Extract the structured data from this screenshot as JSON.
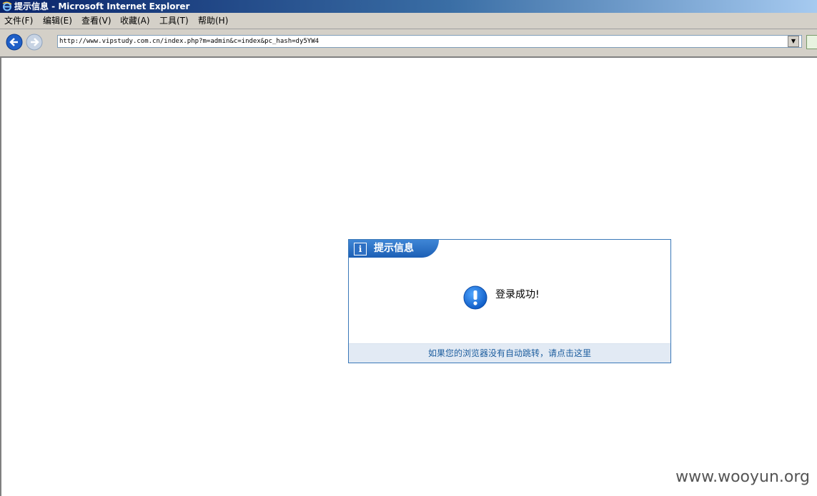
{
  "window": {
    "title": "提示信息 - Microsoft Internet Explorer",
    "icon": "ie-icon"
  },
  "menu": {
    "items": [
      {
        "label": "文件(F)"
      },
      {
        "label": "编辑(E)"
      },
      {
        "label": "查看(V)"
      },
      {
        "label": "收藏(A)"
      },
      {
        "label": "工具(T)"
      },
      {
        "label": "帮助(H)"
      }
    ]
  },
  "navbar": {
    "back_icon": "back-arrow-icon",
    "forward_icon": "forward-arrow-icon",
    "address": "http://www.vipstudy.com.cn/index.php?m=admin&c=index&pc_hash=dy5YW4"
  },
  "dialog": {
    "title": "提示信息",
    "info_icon": "i",
    "message": "登录成功!",
    "redirect_link": "如果您的浏览器没有自动跳转，请点击这里"
  },
  "watermark": "www.wooyun.org",
  "colors": {
    "titlebar_start": "#0a246a",
    "dialog_accent": "#1c5fb5",
    "link": "#1c5d9e",
    "footer_bg": "#e2eaf4"
  }
}
